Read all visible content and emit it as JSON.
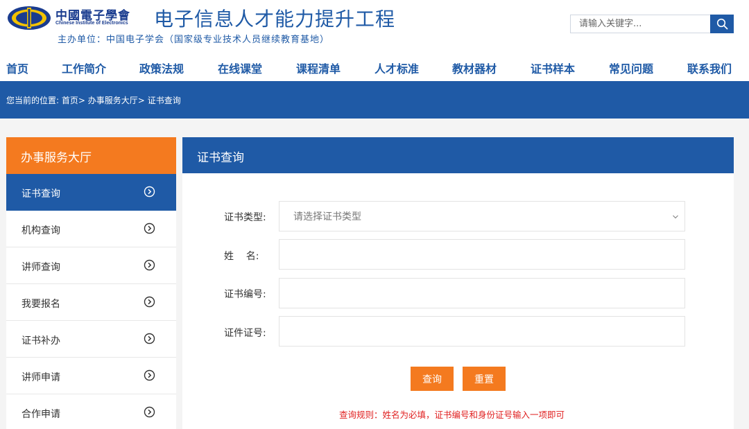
{
  "header": {
    "org_name_cn": "中國電子學會",
    "org_name_en": "Chinese Institute of Electronics",
    "site_title": "电子信息人才能力提升工程",
    "sponsor": "主办单位：中国电子学会（国家级专业技术人员继续教育基地）",
    "search": {
      "placeholder": "请输入关键字...",
      "icon": "search-icon"
    },
    "brand_color": "#1f5aa6"
  },
  "nav": {
    "items": [
      "首页",
      "工作简介",
      "政策法规",
      "在线课堂",
      "课程清单",
      "人才标准",
      "教材器材",
      "证书样本",
      "常见问题",
      "联系我们"
    ]
  },
  "breadcrumb": {
    "prefix": "您当前的位置:",
    "items": [
      "首页",
      "办事服务大厅",
      "证书查询"
    ],
    "separator": ">"
  },
  "sidebar": {
    "title": "办事服务大厅",
    "accent_color": "#f47a1f",
    "active_index": 0,
    "items": [
      {
        "label": "证书查询",
        "icon": "chevron-right-circle-icon"
      },
      {
        "label": "机构查询",
        "icon": "chevron-right-circle-icon"
      },
      {
        "label": "讲师查询",
        "icon": "chevron-right-circle-icon"
      },
      {
        "label": "我要报名",
        "icon": "chevron-right-circle-icon"
      },
      {
        "label": "证书补办",
        "icon": "chevron-right-circle-icon"
      },
      {
        "label": "讲师申请",
        "icon": "chevron-right-circle-icon"
      },
      {
        "label": "合作申请",
        "icon": "chevron-right-circle-icon"
      }
    ]
  },
  "main": {
    "title": "证书查询",
    "form": {
      "cert_type": {
        "label": "证书类型:",
        "selected": "请选择证书类型"
      },
      "name": {
        "label": "姓    名:",
        "value": ""
      },
      "cert_no": {
        "label": "证书编号:",
        "value": ""
      },
      "id_no": {
        "label": "证件证号:",
        "value": ""
      }
    },
    "buttons": {
      "query": "查询",
      "reset": "重置"
    },
    "rule_text": "查询规则：姓名为必填，证书编号和身份证号输入一项即可"
  }
}
